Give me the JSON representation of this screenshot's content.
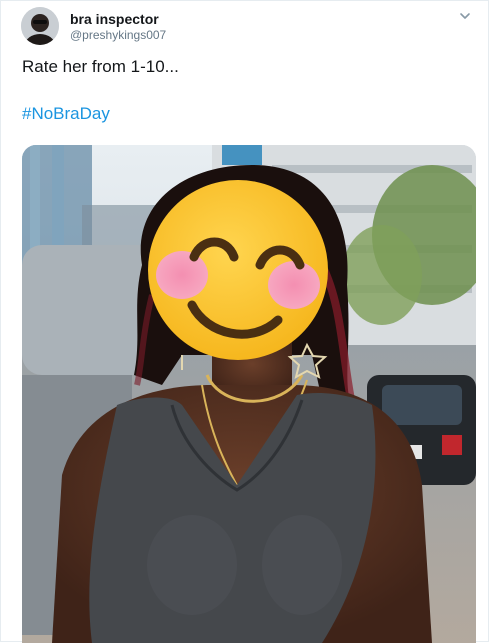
{
  "author": {
    "name": "bra inspector",
    "handle": "@preshykings007",
    "avatar_icon": "user-avatar-photo"
  },
  "tweet": {
    "text": "Rate her from 1-10...",
    "hashtag": "#NoBraDay"
  },
  "menu": {
    "icon": "chevron-down-icon"
  },
  "media": {
    "description_icon": "photo",
    "overlay_emoji": "smiling-face-with-smiling-eyes",
    "colors": {
      "emoji_face": "#fbc02d",
      "emoji_cheeks": "#f48fb1",
      "emoji_features": "#4a2f12",
      "hashtag": "#1b95e0"
    }
  }
}
